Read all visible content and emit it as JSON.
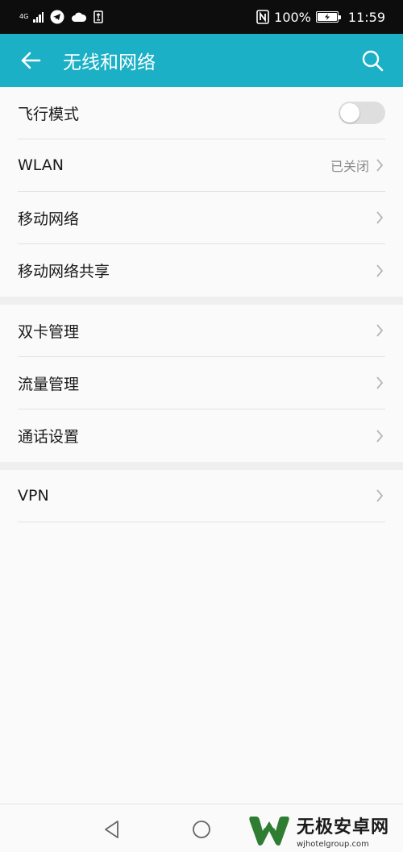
{
  "statusbar": {
    "network": "4G",
    "battery_percent": "100%",
    "time": "11:59",
    "nfc_icon": "N"
  },
  "appbar": {
    "title": "无线和网络"
  },
  "groups": [
    {
      "items": [
        {
          "label": "飞行模式",
          "type": "toggle",
          "on": false
        },
        {
          "label": "WLAN",
          "value": "已关闭"
        },
        {
          "label": "移动网络"
        },
        {
          "label": "移动网络共享"
        }
      ]
    },
    {
      "items": [
        {
          "label": "双卡管理"
        },
        {
          "label": "流量管理"
        },
        {
          "label": "通话设置"
        }
      ]
    },
    {
      "items": [
        {
          "label": "VPN"
        }
      ]
    }
  ],
  "watermark": {
    "main": "无极安卓网",
    "sub": "wjhotelgroup.com"
  },
  "colors": {
    "accent": "#1bb0c6",
    "statusbar": "#0d0d0d",
    "background": "#fafafa"
  }
}
